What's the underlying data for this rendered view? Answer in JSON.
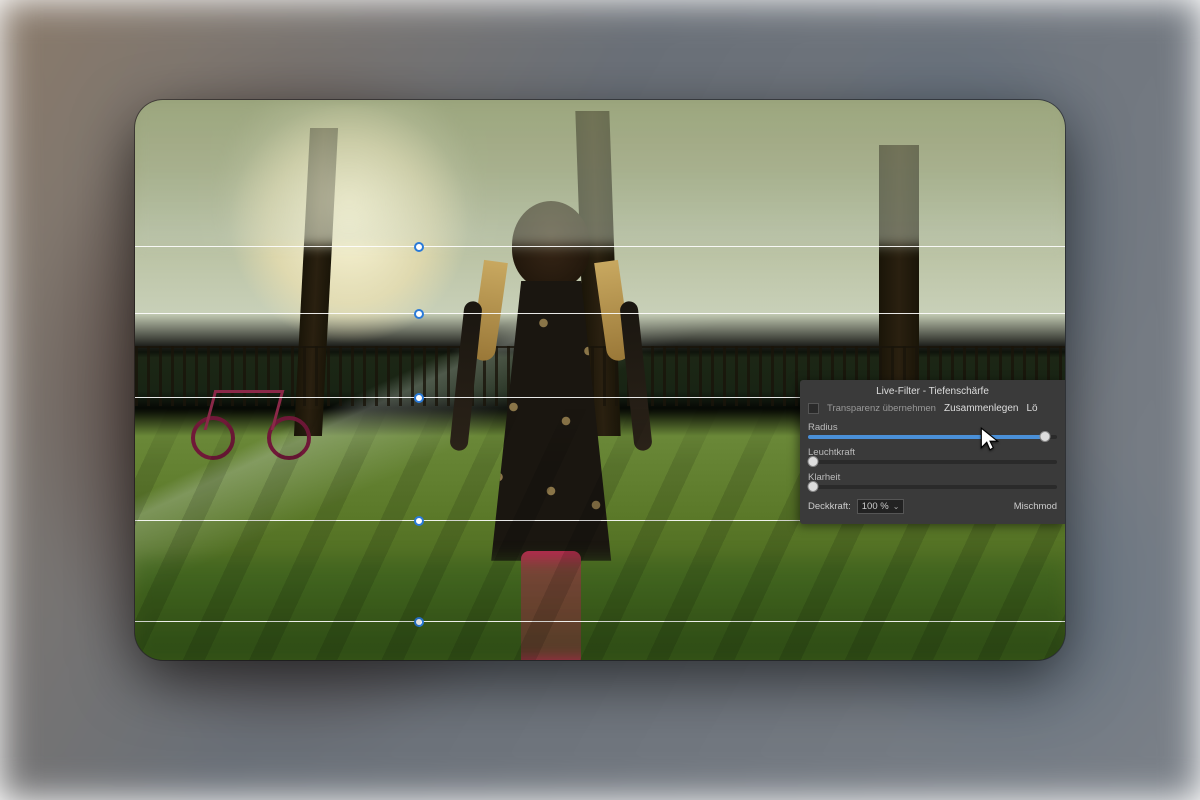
{
  "panel": {
    "title": "Live-Filter - Tiefenschärfe",
    "preserve_alpha_label": "Transparenz übernehmen",
    "merge_label": "Zusammenlegen",
    "delete_label": "Lö",
    "sliders": {
      "radius": {
        "label": "Radius",
        "value_pct": 95
      },
      "vibrance": {
        "label": "Leuchtkraft",
        "value_pct": 2
      },
      "clarity": {
        "label": "Klarheit",
        "value_pct": 2
      }
    },
    "opacity_label": "Deckkraft:",
    "opacity_value": "100 %",
    "blend_label": "Mischmod"
  },
  "guides": {
    "count": 5
  },
  "colors": {
    "accent": "#4a90d8",
    "panel_bg": "#3a3a3a"
  }
}
